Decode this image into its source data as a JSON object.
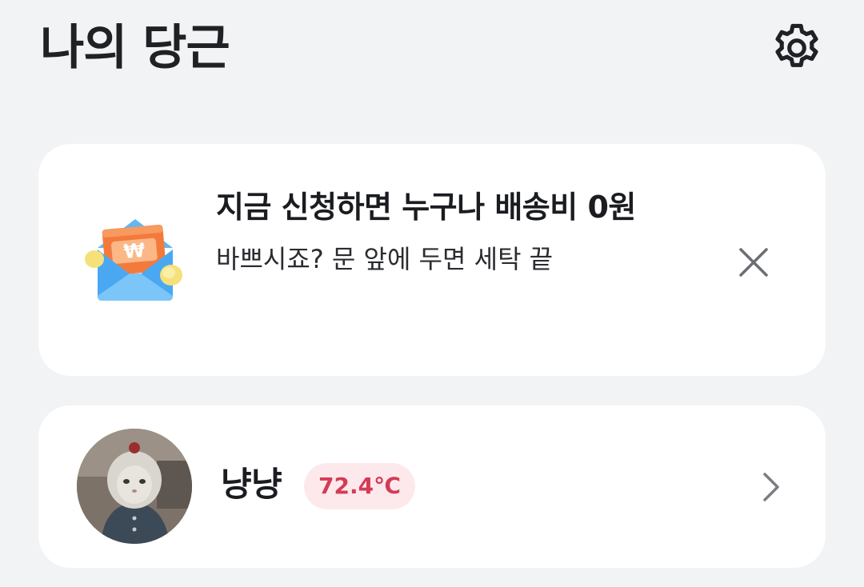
{
  "header": {
    "title": "나의 당근",
    "settings_icon": "gear-icon"
  },
  "promo": {
    "icon": "envelope-won-icon",
    "title": "지금 신청하면 누구나 배송비 0원",
    "subtitle": "바쁘시죠? 문 앞에 두면 세탁 끝",
    "close_icon": "close-icon"
  },
  "profile": {
    "name": "냥냥",
    "temperature": "72.4℃",
    "avatar": "cat-avatar",
    "chevron_icon": "chevron-right-icon"
  },
  "colors": {
    "background": "#f2f3f5",
    "card": "#ffffff",
    "badge_bg": "#fde9ec",
    "badge_text": "#d43b55",
    "envelope": "#4aa8f2",
    "won_card": "#f47a3c"
  }
}
